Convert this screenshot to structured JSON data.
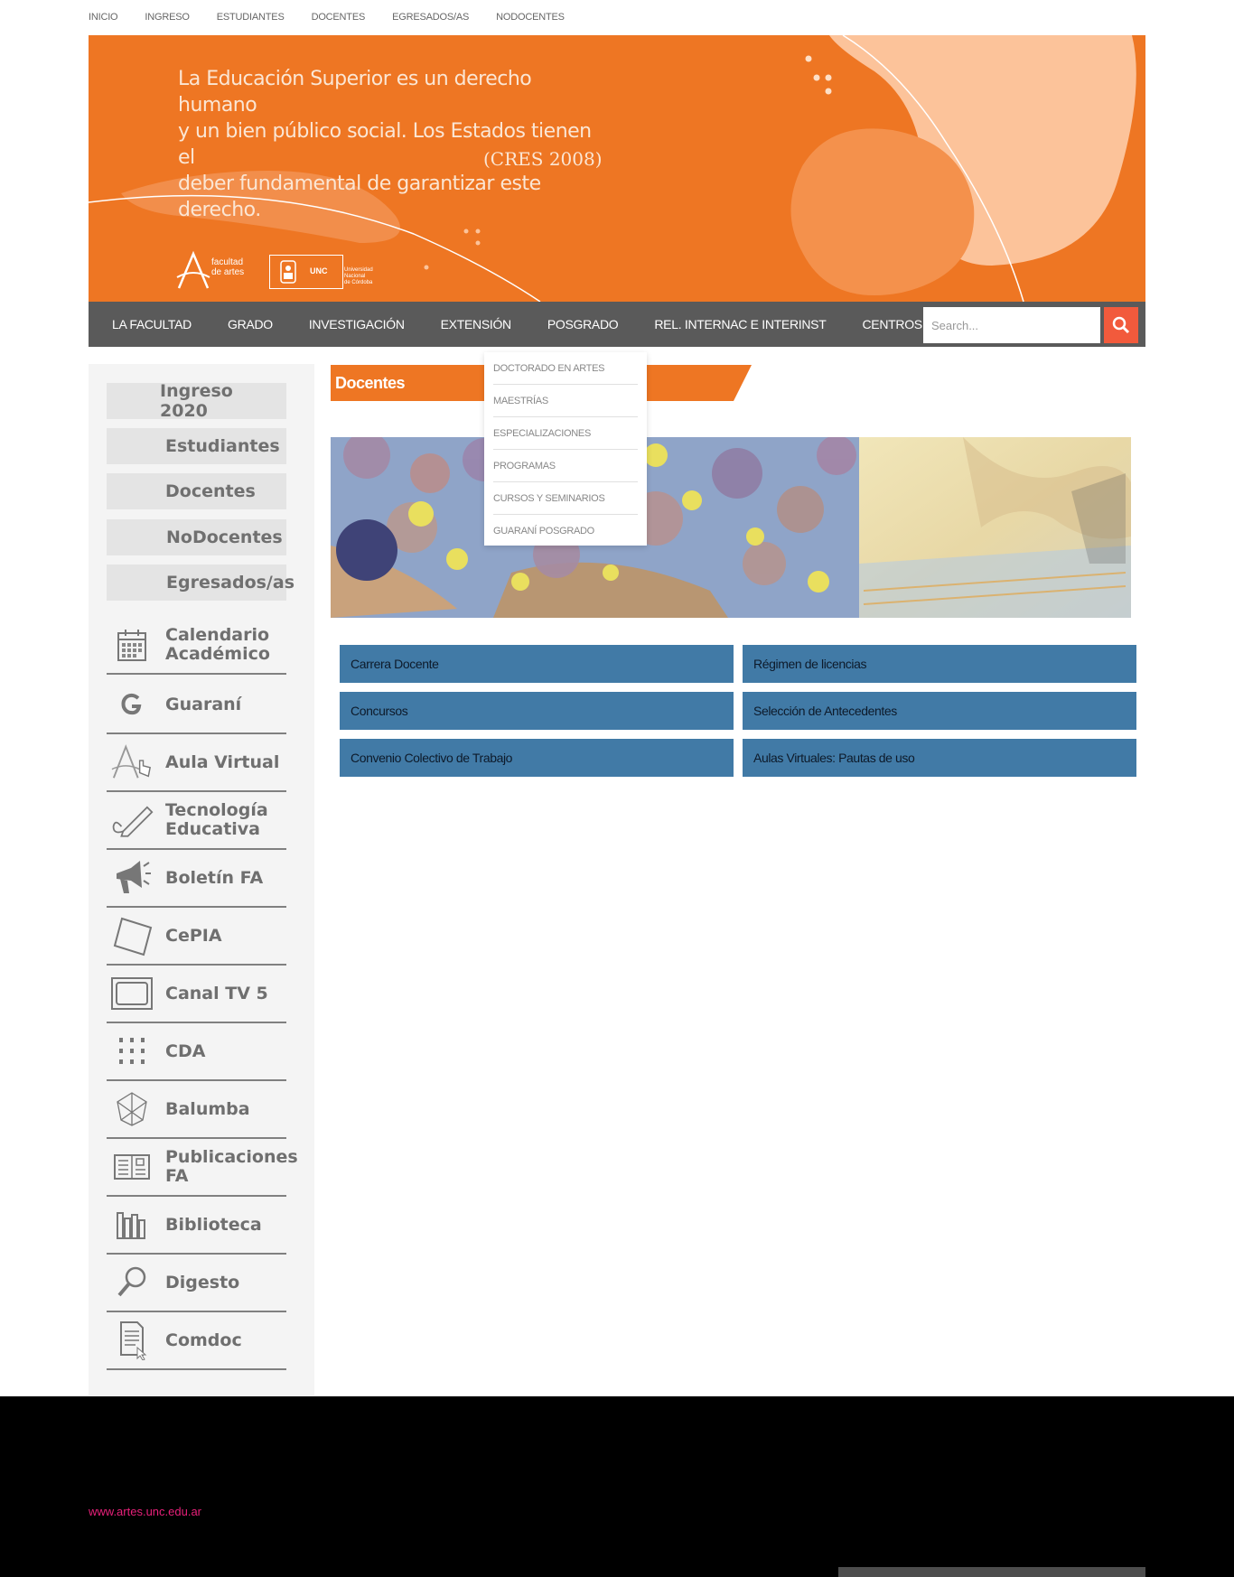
{
  "top_nav": [
    "INICIO",
    "INGRESO",
    "ESTUDIANTES",
    "DOCENTES",
    "EGRESADOS/AS",
    "NODOCENTES"
  ],
  "banner": {
    "quote_lines": [
      "La Educación Superior es un derecho humano",
      "y un bien público social. Los Estados tienen el",
      "deber fundamental de garantizar este derecho."
    ],
    "quote_source": "(CRES 2008)",
    "logo_fa_line1": "facultad",
    "logo_fa_line2": "de artes",
    "logo_unc": "UNC",
    "logo_unc_line1": "Universidad",
    "logo_unc_line2": "Nacional",
    "logo_unc_line3": "de Córdoba"
  },
  "main_nav": [
    "LA FACULTAD",
    "GRADO",
    "INVESTIGACIÓN",
    "EXTENSIÓN",
    "POSGRADO",
    "REL. INTERNAC E INTERINST",
    "CENTROS"
  ],
  "search": {
    "placeholder": "Search..."
  },
  "dropdown_posgrado": [
    "DOCTORADO EN ARTES",
    "MAESTRÍAS",
    "ESPECIALIZACIONES",
    "PROGRAMAS",
    "CURSOS Y SEMINARIOS",
    "GUARANÍ POSGRADO"
  ],
  "sidebar": {
    "pills": [
      "Ingreso 2020",
      "Estudiantes",
      "Docentes",
      "NoDocentes",
      "Egresados/as"
    ],
    "links": [
      {
        "label_1": "Calendario",
        "label_2": "Académico",
        "icon": "calendar-icon"
      },
      {
        "label_1": "Guaraní",
        "label_2": "",
        "icon": "guarani-icon"
      },
      {
        "label_1": "Aula Virtual",
        "label_2": "",
        "icon": "aula-virtual-icon"
      },
      {
        "label_1": "Tecnología",
        "label_2": "Educativa",
        "icon": "pen-icon"
      },
      {
        "label_1": "Boletín FA",
        "label_2": "",
        "icon": "megaphone-icon"
      },
      {
        "label_1": "CePIA",
        "label_2": "",
        "icon": "cepia-icon"
      },
      {
        "label_1": "Canal TV 5",
        "label_2": "",
        "icon": "tv-icon"
      },
      {
        "label_1": "CDA",
        "label_2": "",
        "icon": "dots-icon"
      },
      {
        "label_1": "Balumba",
        "label_2": "",
        "icon": "balumba-icon"
      },
      {
        "label_1": "Publicaciones",
        "label_2": "FA",
        "icon": "newspaper-icon"
      },
      {
        "label_1": "Biblioteca",
        "label_2": "",
        "icon": "books-icon"
      },
      {
        "label_1": "Digesto",
        "label_2": "",
        "icon": "magnifier-icon"
      },
      {
        "label_1": "Comdoc",
        "label_2": "",
        "icon": "document-icon"
      }
    ]
  },
  "content": {
    "title": "Docentes",
    "buttons": [
      "Carrera Docente",
      "Régimen de licencias",
      "Concursos",
      "Selección de Antecedentes",
      "Convenio Colectivo de Trabajo",
      "Aulas Virtuales: Pautas de uso"
    ]
  },
  "footer": {
    "url": "www.artes.unc.edu.ar"
  },
  "colors": {
    "orange": "#ee7623",
    "nav_gray": "#5a5a5a",
    "button_blue": "#417aa6",
    "search_red": "#f25a3c",
    "footer_link": "#e8207a"
  }
}
